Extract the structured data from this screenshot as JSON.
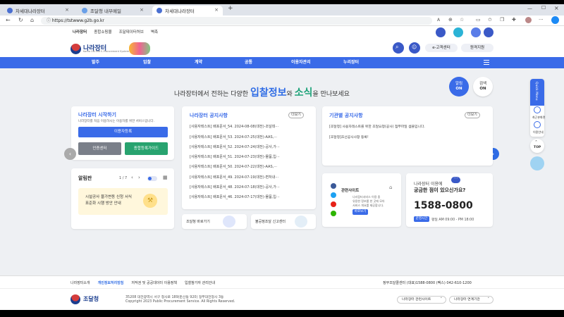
{
  "browser": {
    "tabs": [
      {
        "label": "차세대나라장터"
      },
      {
        "label": "조달청 내부메일"
      },
      {
        "label": "차세대나라장터"
      }
    ],
    "url": "https://tstwww.g2b.go.kr"
  },
  "toplinks": [
    "나라장터",
    "종합쇼핑몰",
    "조달데이터허브",
    "벽촉"
  ],
  "logo": {
    "title": "나라장터",
    "subtitle": "Korea ON-line E-Procurement System"
  },
  "header": {
    "ecenter": "e-고객센터",
    "remote": "원격지원"
  },
  "nav": [
    "발주",
    "입찰",
    "계약",
    "공통",
    "이용자관리",
    "누리장터"
  ],
  "headline": {
    "pre": "나라장터에서 전하는 다양한",
    "hl1": "입찰정보",
    "mid": "와",
    "hl2": "소식",
    "post": "을 만나보세요"
  },
  "badges": {
    "alarm1": "알림",
    "alarm2": "ON",
    "search1": "검색",
    "search2": "ON"
  },
  "start": {
    "title": "나라장터 시작하기",
    "desc": "나라장터를 처음 이용하시는 이용자를 위한 서비스입니다.",
    "register": "이용자등록",
    "cert": "인증센터",
    "guide": "종합등록가이드"
  },
  "alarm": {
    "title": "알림판",
    "page": "1 / 7",
    "msg1": "시설공사 물가변동 신청 서식",
    "msg2": "표준화 시행 방안 안내"
  },
  "notice": {
    "title": "나라장터 공지사항",
    "more": "더보기",
    "items": [
      "[사용자테스트] 배포문서_54. 2024-08-08(대전)-조달데···",
      "[사용자테스트] 배포문서_53. 2024-07-25(대전)-AAS,···",
      "[사용자테스트] 배포문서_52. 2024-07-24(대전)-공사,가···",
      "[사용자테스트] 배포문서_51. 2024-07-23(대전)-물품,입···",
      "[사용자테스트] 배포문서_50. 2024-07-22(대전)-AAS,···",
      "[사용자테스트] 배포문서_49. 2024-07-19(대전)-변처내···",
      "[사용자테스트] 배포문서_48. 2024-07-18(대전)-공사,가···",
      "[사용자테스트] 배포문서_46. 2024-07-17(대전)-물품,입···"
    ],
    "link1": "조달청 바로가기",
    "link2": "불공정조달 신고센터"
  },
  "agency": {
    "title": "기관별 공지사항",
    "more": "더보기",
    "items": [
      "[조달청] 사용자테스트를 위한 조달요청(공사) 점부파일 샘플입니다.",
      "[조달청]조선공사사항 등록!"
    ]
  },
  "related": {
    "title": "관련사이트",
    "desc1": "나라장터서비스 이용 중",
    "desc2": "유용한 정보를 한 곳에 모아",
    "desc3": "서비스 개요를 제공합니다.",
    "btn": "바로보기"
  },
  "contact": {
    "q1": "나라장터 이용에",
    "q2": "궁금한 점이 있으신가요?",
    "phone": "1588-0800",
    "hours_label": "운영시간",
    "hours": "평일 AM 09:00 - PM 18:00"
  },
  "side": {
    "quick": "Quick Menu",
    "recent": "최근본화면",
    "guide": "이용안내",
    "top": "TOP"
  },
  "footer": {
    "links": [
      "나라장터소개",
      "개인정보처리방침",
      "저작권 및 공공데이터 이용정책",
      "입찰참가자 관리안내"
    ],
    "contact": "정부조달콜센터 (대표)1588-0800 (팩스) 042-610-1200",
    "org": "조달청",
    "addr": "35208 대전광역시 서구 청사로 189(둔산동 920) 정부대전청사 3동",
    "copy": "Copyright 2023 Public Procurement Service. All Rights Reserved.",
    "site1": "나라장터 관련사이트",
    "site2": "나라장터 연계기관"
  }
}
